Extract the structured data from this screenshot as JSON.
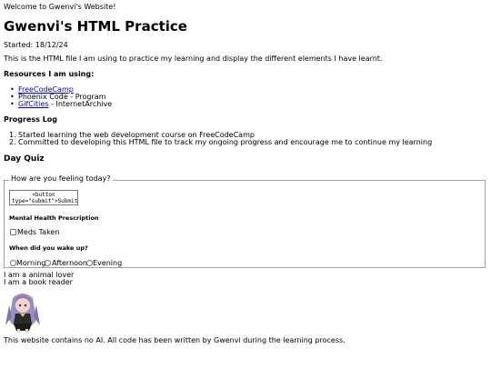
{
  "welcome": "Welcome to Gwenvi's Website!",
  "title": "Gwenvi's HTML Practice",
  "started": "Started: 18/12/24",
  "intro": "This is the HTML file I am using to practice my learning and display the different elements I have learnt.",
  "resources": {
    "heading": "Resources I am using:",
    "items": [
      {
        "link": "FreeCodeCamp",
        "suffix": ""
      },
      {
        "link": "",
        "suffix": "Phoenix Code - Program"
      },
      {
        "link": "GifCities",
        "suffix": " - InternetArchive"
      }
    ]
  },
  "progress": {
    "heading": "Progress Log",
    "items": [
      "Started learning the web development course on FreeCodeCamp",
      "Committed to developing this HTML file to track my ongoing progress and encourage me to continue my learning"
    ]
  },
  "quiz": {
    "heading": "Day Quiz",
    "legend": "How are you feeling today?",
    "textarea_value": "<button type=\"submit\">Submit",
    "mental_heading": "Mental Health Prescription",
    "meds_label": "Meds Taken",
    "wake_heading": "When did you wake up?",
    "options": [
      "Morning",
      "Afternoon",
      "Evening"
    ]
  },
  "facts": [
    "I am a animal lover",
    "I am a book reader"
  ],
  "footer": "This website contains no AI. All code has been written by Gwenvi during the learning process.",
  "icons": {
    "avatar": "anime-character-gif"
  }
}
